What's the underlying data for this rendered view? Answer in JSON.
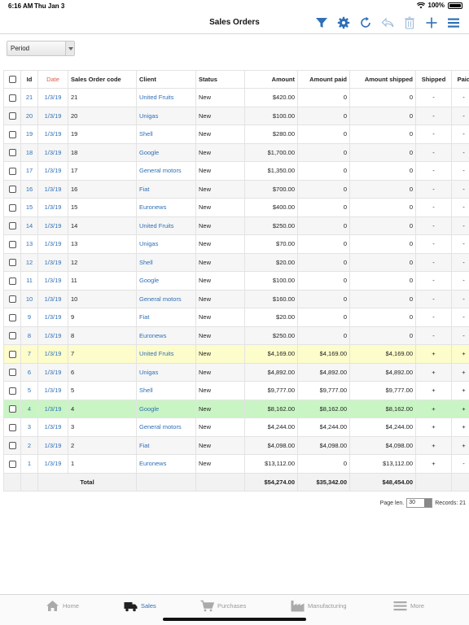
{
  "status_bar": {
    "time": "6:16 AM",
    "date": "Thu Jan 3",
    "battery": "100%"
  },
  "header": {
    "title": "Sales Orders"
  },
  "nav_icons": [
    "filter-icon",
    "gear-icon",
    "refresh-icon",
    "reply-icon",
    "trash-icon",
    "plus-icon",
    "menu-icon"
  ],
  "colors": {
    "accent": "#2f6fb6",
    "date_header": "#e05a4a",
    "highlight_yellow": "#fdfccb",
    "highlight_green": "#c9f5c4"
  },
  "filter": {
    "period_label": "Period"
  },
  "table": {
    "headers": [
      "Id",
      "Date",
      "Sales Order code",
      "Client",
      "Status",
      "Amount",
      "Amount paid",
      "Amount shipped",
      "Shipped",
      "Paid"
    ],
    "rows": [
      [
        "21",
        "1/3/19",
        "21",
        "United Fruits",
        "New",
        "$420.00",
        "0",
        "0",
        "-",
        "-"
      ],
      [
        "20",
        "1/3/19",
        "20",
        "Unigas",
        "New",
        "$100.00",
        "0",
        "0",
        "-",
        "-"
      ],
      [
        "19",
        "1/3/19",
        "19",
        "Shell",
        "New",
        "$280.00",
        "0",
        "0",
        "-",
        "-"
      ],
      [
        "18",
        "1/3/19",
        "18",
        "Google",
        "New",
        "$1,700.00",
        "0",
        "0",
        "-",
        "-"
      ],
      [
        "17",
        "1/3/19",
        "17",
        "General motors",
        "New",
        "$1,350.00",
        "0",
        "0",
        "-",
        "-"
      ],
      [
        "16",
        "1/3/19",
        "16",
        "Fiat",
        "New",
        "$700.00",
        "0",
        "0",
        "-",
        "-"
      ],
      [
        "15",
        "1/3/19",
        "15",
        "Euronews",
        "New",
        "$400.00",
        "0",
        "0",
        "-",
        "-"
      ],
      [
        "14",
        "1/3/19",
        "14",
        "United Fruits",
        "New",
        "$250.00",
        "0",
        "0",
        "-",
        "-"
      ],
      [
        "13",
        "1/3/19",
        "13",
        "Unigas",
        "New",
        "$70.00",
        "0",
        "0",
        "-",
        "-"
      ],
      [
        "12",
        "1/3/19",
        "12",
        "Shell",
        "New",
        "$20.00",
        "0",
        "0",
        "-",
        "-"
      ],
      [
        "11",
        "1/3/19",
        "11",
        "Google",
        "New",
        "$100.00",
        "0",
        "0",
        "-",
        "-"
      ],
      [
        "10",
        "1/3/19",
        "10",
        "General motors",
        "New",
        "$160.00",
        "0",
        "0",
        "-",
        "-"
      ],
      [
        "9",
        "1/3/19",
        "9",
        "Fiat",
        "New",
        "$20.00",
        "0",
        "0",
        "-",
        "-"
      ],
      [
        "8",
        "1/3/19",
        "8",
        "Euronews",
        "New",
        "$250.00",
        "0",
        "0",
        "-",
        "-"
      ],
      [
        "7",
        "1/3/19",
        "7",
        "United Fruits",
        "New",
        "$4,169.00",
        "$4,169.00",
        "$4,169.00",
        "+",
        "+"
      ],
      [
        "6",
        "1/3/19",
        "6",
        "Unigas",
        "New",
        "$4,892.00",
        "$4,892.00",
        "$4,892.00",
        "+",
        "+"
      ],
      [
        "5",
        "1/3/19",
        "5",
        "Shell",
        "New",
        "$9,777.00",
        "$9,777.00",
        "$9,777.00",
        "+",
        "+"
      ],
      [
        "4",
        "1/3/19",
        "4",
        "Google",
        "New",
        "$8,162.00",
        "$8,162.00",
        "$8,162.00",
        "+",
        "+"
      ],
      [
        "3",
        "1/3/19",
        "3",
        "General motors",
        "New",
        "$4,244.00",
        "$4,244.00",
        "$4,244.00",
        "+",
        "+"
      ],
      [
        "2",
        "1/3/19",
        "2",
        "Fiat",
        "New",
        "$4,098.00",
        "$4,098.00",
        "$4,098.00",
        "+",
        "+"
      ],
      [
        "1",
        "1/3/19",
        "1",
        "Euronews",
        "New",
        "$13,112.00",
        "0",
        "$13,112.00",
        "+",
        "-"
      ]
    ],
    "highlight_yellow_row": "7",
    "highlight_green_row": "4",
    "footer": {
      "label": "Total",
      "amount": "$54,274.00",
      "amount_paid": "$35,342.00",
      "amount_shipped": "$48,454.00"
    }
  },
  "pager": {
    "page_len_label": "Page len.",
    "page_len_value": "30",
    "records_label": "Records: 21"
  },
  "tabbar": {
    "items": [
      {
        "label": "Home",
        "icon": "home-icon"
      },
      {
        "label": "Sales",
        "icon": "truck-icon",
        "active": true
      },
      {
        "label": "Purchases",
        "icon": "cart-icon"
      },
      {
        "label": "Manufacturing",
        "icon": "factory-icon"
      },
      {
        "label": "More",
        "icon": "menu-icon"
      }
    ]
  }
}
